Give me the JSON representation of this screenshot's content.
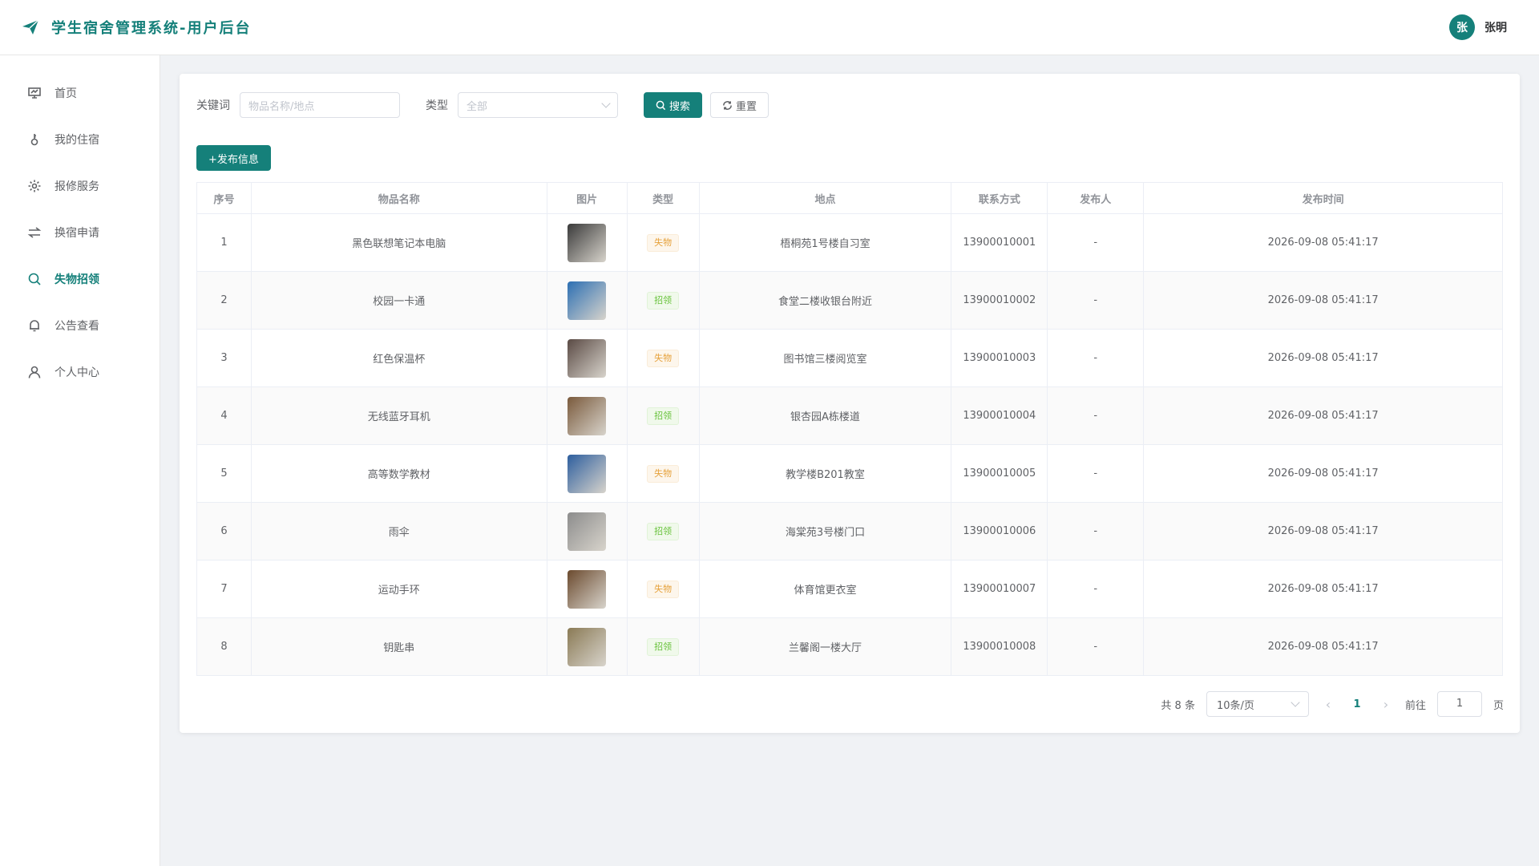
{
  "header": {
    "title": "学生宿舍管理系统-用户后台",
    "avatar_char": "张",
    "user_name": "张明"
  },
  "sidebar": {
    "items": [
      {
        "label": "首页",
        "icon": "dashboard-icon",
        "active": false
      },
      {
        "label": "我的住宿",
        "icon": "key-icon",
        "active": false
      },
      {
        "label": "报修服务",
        "icon": "gear-icon",
        "active": false
      },
      {
        "label": "换宿申请",
        "icon": "swap-icon",
        "active": false
      },
      {
        "label": "失物招领",
        "icon": "search-icon",
        "active": true
      },
      {
        "label": "公告查看",
        "icon": "bell-icon",
        "active": false
      },
      {
        "label": "个人中心",
        "icon": "user-icon",
        "active": false
      }
    ]
  },
  "filters": {
    "keyword_label": "关键词",
    "keyword_placeholder": "物品名称/地点",
    "type_label": "类型",
    "type_value": "全部",
    "search_label": "搜索",
    "reset_label": "重置"
  },
  "publish_label": "+发布信息",
  "table": {
    "headers": [
      "序号",
      "物品名称",
      "图片",
      "类型",
      "地点",
      "联系方式",
      "发布人",
      "发布时间"
    ],
    "rows": [
      {
        "no": "1",
        "name": "黑色联想笔记本电脑",
        "type": "失物",
        "kind": "lost",
        "place": "梧桐苑1号楼自习室",
        "phone": "13900010001",
        "publisher": "-",
        "time": "2026-09-08 05:41:17",
        "thumb": "#3a3a3a"
      },
      {
        "no": "2",
        "name": "校园一卡通",
        "type": "招领",
        "kind": "found",
        "place": "食堂二楼收银台附近",
        "phone": "13900010002",
        "publisher": "-",
        "time": "2026-09-08 05:41:17",
        "thumb": "#2c6fb3"
      },
      {
        "no": "3",
        "name": "红色保温杯",
        "type": "失物",
        "kind": "lost",
        "place": "图书馆三楼阅览室",
        "phone": "13900010003",
        "publisher": "-",
        "time": "2026-09-08 05:41:17",
        "thumb": "#5a4a44"
      },
      {
        "no": "4",
        "name": "无线蓝牙耳机",
        "type": "招领",
        "kind": "found",
        "place": "银杏园A栋楼道",
        "phone": "13900010004",
        "publisher": "-",
        "time": "2026-09-08 05:41:17",
        "thumb": "#7a5a3c"
      },
      {
        "no": "5",
        "name": "高等数学教材",
        "type": "失物",
        "kind": "lost",
        "place": "教学楼B201教室",
        "phone": "13900010005",
        "publisher": "-",
        "time": "2026-09-08 05:41:17",
        "thumb": "#2d5e9e"
      },
      {
        "no": "6",
        "name": "雨伞",
        "type": "招领",
        "kind": "found",
        "place": "海棠苑3号楼门口",
        "phone": "13900010006",
        "publisher": "-",
        "time": "2026-09-08 05:41:17",
        "thumb": "#8c8c8c"
      },
      {
        "no": "7",
        "name": "运动手环",
        "type": "失物",
        "kind": "lost",
        "place": "体育馆更衣室",
        "phone": "13900010007",
        "publisher": "-",
        "time": "2026-09-08 05:41:17",
        "thumb": "#6b4a2e"
      },
      {
        "no": "8",
        "name": "钥匙串",
        "type": "招领",
        "kind": "found",
        "place": "兰馨阁一楼大厅",
        "phone": "13900010008",
        "publisher": "-",
        "time": "2026-09-08 05:41:17",
        "thumb": "#8a7a55"
      }
    ]
  },
  "pagination": {
    "total_text": "共 8 条",
    "page_size": "10条/页",
    "current_page": "1",
    "goto_label": "前往",
    "goto_value": "1",
    "page_suffix": "页"
  },
  "colors": {
    "primary": "#15807a",
    "lost_tag": "#e6a23c",
    "found_tag": "#67c23a"
  }
}
